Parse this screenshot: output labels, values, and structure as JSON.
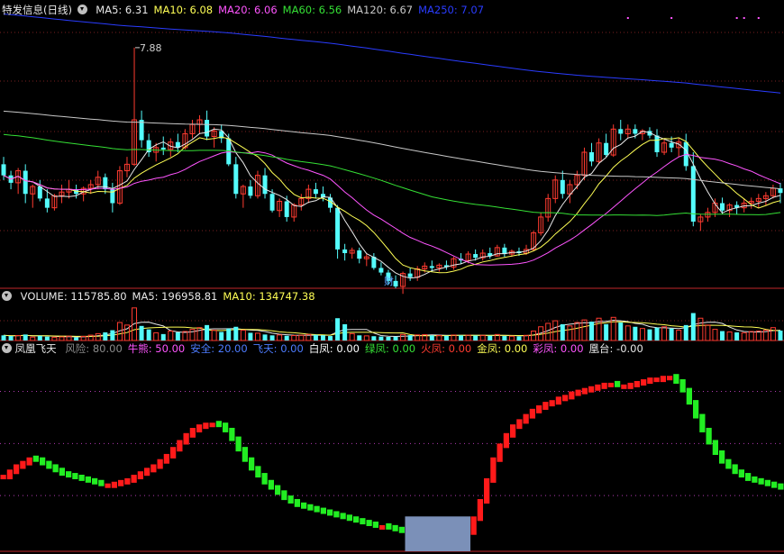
{
  "colors": {
    "background": "#000000",
    "grid": "#7a1f1f",
    "separator": "#c2262a",
    "up": "#ff3b30",
    "down": "#54fcfc",
    "ma5": "#e8e8e8",
    "ma10": "#ffff55",
    "ma20": "#ff55ff",
    "ma60": "#35e035",
    "ma120": "#c8c8c8",
    "ma250": "#2a3cff",
    "pane3_grid": "#b03ab0",
    "block": "#7b90b8"
  },
  "price_panel": {
    "title": "特发信息(日线)",
    "ma": [
      {
        "label": "MA5:",
        "value": "6.31",
        "color": "#e8e8e8"
      },
      {
        "label": "MA10:",
        "value": "6.08",
        "color": "#ffff55"
      },
      {
        "label": "MA20:",
        "value": "6.06",
        "color": "#ff55ff"
      },
      {
        "label": "MA60:",
        "value": "6.56",
        "color": "#35e035"
      },
      {
        "label": "MA120:",
        "value": "6.67",
        "color": "#c8c8c8"
      },
      {
        "label": "MA250:",
        "value": "7.07",
        "color": "#2a3cff"
      }
    ],
    "annotations": {
      "high_label": "7.88",
      "event_marker": "财"
    }
  },
  "volume_panel": {
    "items": [
      {
        "label": "VOLUME:",
        "value": "115785.80",
        "color": "#e8e8e8"
      },
      {
        "label": "MA5:",
        "value": "196958.81",
        "color": "#e8e8e8"
      },
      {
        "label": "MA10:",
        "value": "134747.38",
        "color": "#ffff55"
      }
    ]
  },
  "indicator_panel": {
    "title": "凤凰飞天",
    "items": [
      {
        "label": "风险:",
        "value": "80.00",
        "color": "#8a8a8a"
      },
      {
        "label": "牛熊:",
        "value": "50.00",
        "color": "#ff55ff"
      },
      {
        "label": "安全:",
        "value": "20.00",
        "color": "#4d7cff"
      },
      {
        "label": "飞天:",
        "value": "0.00",
        "color": "#4d7cff"
      },
      {
        "label": "白凤:",
        "value": "0.00",
        "color": "#ffffff"
      },
      {
        "label": "绿凤:",
        "value": "0.00",
        "color": "#35e035"
      },
      {
        "label": "火凤:",
        "value": "0.00",
        "color": "#ff3b30"
      },
      {
        "label": "金凤:",
        "value": "0.00",
        "color": "#ffff55"
      },
      {
        "label": "彩凤:",
        "value": "0.00",
        "color": "#ff55ff"
      },
      {
        "label": "凰台:",
        "value": "-0.00",
        "color": "#e8e8e8"
      }
    ]
  },
  "chart_data": [
    {
      "type": "candlestick",
      "title": "特发信息(日线)",
      "ylim": [
        5.3,
        8.2
      ],
      "note": "values estimated from the visible chart",
      "ohlc": [
        [
          6.62,
          6.7,
          6.45,
          6.5
        ],
        [
          6.5,
          6.55,
          6.35,
          6.42
        ],
        [
          6.42,
          6.58,
          6.3,
          6.55
        ],
        [
          6.55,
          6.62,
          6.2,
          6.3
        ],
        [
          6.3,
          6.4,
          6.15,
          6.38
        ],
        [
          6.38,
          6.45,
          6.22,
          6.25
        ],
        [
          6.25,
          6.35,
          6.1,
          6.15
        ],
        [
          6.15,
          6.3,
          6.12,
          6.28
        ],
        [
          6.28,
          6.4,
          6.2,
          6.32
        ],
        [
          6.32,
          6.45,
          6.25,
          6.35
        ],
        [
          6.35,
          6.4,
          6.25,
          6.3
        ],
        [
          6.3,
          6.38,
          6.22,
          6.36
        ],
        [
          6.36,
          6.45,
          6.3,
          6.4
        ],
        [
          6.4,
          6.55,
          6.35,
          6.48
        ],
        [
          6.48,
          6.52,
          6.3,
          6.35
        ],
        [
          6.35,
          6.42,
          6.1,
          6.2
        ],
        [
          6.2,
          6.6,
          6.18,
          6.55
        ],
        [
          6.55,
          6.7,
          6.48,
          6.62
        ],
        [
          6.62,
          7.88,
          6.6,
          7.1
        ],
        [
          7.1,
          7.2,
          6.8,
          6.88
        ],
        [
          6.88,
          6.95,
          6.7,
          6.75
        ],
        [
          6.75,
          6.85,
          6.65,
          6.8
        ],
        [
          6.8,
          6.92,
          6.72,
          6.78
        ],
        [
          6.78,
          6.9,
          6.7,
          6.86
        ],
        [
          6.86,
          6.95,
          6.75,
          6.8
        ],
        [
          6.8,
          7.0,
          6.78,
          6.95
        ],
        [
          6.95,
          7.1,
          6.9,
          7.05
        ],
        [
          7.05,
          7.15,
          6.95,
          7.1
        ],
        [
          7.1,
          7.2,
          6.88,
          6.92
        ],
        [
          6.92,
          7.02,
          6.8,
          6.98
        ],
        [
          6.98,
          7.05,
          6.85,
          6.9
        ],
        [
          6.9,
          6.95,
          6.6,
          6.62
        ],
        [
          6.62,
          6.7,
          6.25,
          6.3
        ],
        [
          6.3,
          6.4,
          6.15,
          6.38
        ],
        [
          6.38,
          6.45,
          6.25,
          6.28
        ],
        [
          6.28,
          6.55,
          6.25,
          6.5
        ],
        [
          6.5,
          6.58,
          6.25,
          6.3
        ],
        [
          6.3,
          6.35,
          6.1,
          6.12
        ],
        [
          6.12,
          6.25,
          6.05,
          6.22
        ],
        [
          6.22,
          6.28,
          6.0,
          6.05
        ],
        [
          6.05,
          6.2,
          6.0,
          6.18
        ],
        [
          6.18,
          6.3,
          6.12,
          6.25
        ],
        [
          6.25,
          6.4,
          6.2,
          6.35
        ],
        [
          6.35,
          6.42,
          6.25,
          6.3
        ],
        [
          6.3,
          6.38,
          6.22,
          6.26
        ],
        [
          6.26,
          6.3,
          6.1,
          6.15
        ],
        [
          6.15,
          6.18,
          5.6,
          5.7
        ],
        [
          5.7,
          5.76,
          5.58,
          5.66
        ],
        [
          5.66,
          5.72,
          5.6,
          5.69
        ],
        [
          5.69,
          5.72,
          5.55,
          5.6
        ],
        [
          5.6,
          5.65,
          5.52,
          5.62
        ],
        [
          5.62,
          5.66,
          5.48,
          5.5
        ],
        [
          5.5,
          5.56,
          5.42,
          5.45
        ],
        [
          5.45,
          5.48,
          5.32,
          5.36
        ],
        [
          5.36,
          5.42,
          5.28,
          5.3
        ],
        [
          5.3,
          5.46,
          5.22,
          5.44
        ],
        [
          5.44,
          5.5,
          5.36,
          5.4
        ],
        [
          5.4,
          5.52,
          5.36,
          5.49
        ],
        [
          5.49,
          5.56,
          5.45,
          5.52
        ],
        [
          5.52,
          5.58,
          5.46,
          5.5
        ],
        [
          5.5,
          5.55,
          5.46,
          5.53
        ],
        [
          5.53,
          5.58,
          5.48,
          5.51
        ],
        [
          5.51,
          5.62,
          5.48,
          5.6
        ],
        [
          5.6,
          5.66,
          5.54,
          5.58
        ],
        [
          5.58,
          5.68,
          5.55,
          5.65
        ],
        [
          5.65,
          5.7,
          5.58,
          5.61
        ],
        [
          5.61,
          5.7,
          5.58,
          5.66
        ],
        [
          5.66,
          5.72,
          5.6,
          5.63
        ],
        [
          5.63,
          5.75,
          5.62,
          5.72
        ],
        [
          5.72,
          5.76,
          5.62,
          5.65
        ],
        [
          5.65,
          5.7,
          5.62,
          5.68
        ],
        [
          5.68,
          5.72,
          5.63,
          5.66
        ],
        [
          5.66,
          5.75,
          5.64,
          5.7
        ],
        [
          5.7,
          5.9,
          5.68,
          5.88
        ],
        [
          5.88,
          6.1,
          5.85,
          6.05
        ],
        [
          6.05,
          6.3,
          6.0,
          6.25
        ],
        [
          6.25,
          6.5,
          6.2,
          6.45
        ],
        [
          6.45,
          6.55,
          6.25,
          6.3
        ],
        [
          6.3,
          6.45,
          6.2,
          6.4
        ],
        [
          6.4,
          6.55,
          6.35,
          6.5
        ],
        [
          6.5,
          6.8,
          6.45,
          6.75
        ],
        [
          6.75,
          6.85,
          6.6,
          6.65
        ],
        [
          6.65,
          6.9,
          6.62,
          6.85
        ],
        [
          6.85,
          6.95,
          6.7,
          6.72
        ],
        [
          6.72,
          7.05,
          6.7,
          7.0
        ],
        [
          7.0,
          7.1,
          6.88,
          6.95
        ],
        [
          6.95,
          7.05,
          6.9,
          7.0
        ],
        [
          7.0,
          7.05,
          6.9,
          6.95
        ],
        [
          6.95,
          7.0,
          6.88,
          6.98
        ],
        [
          6.98,
          7.02,
          6.9,
          6.93
        ],
        [
          6.93,
          7.0,
          6.7,
          6.75
        ],
        [
          6.75,
          6.9,
          6.72,
          6.85
        ],
        [
          6.85,
          6.92,
          6.75,
          6.8
        ],
        [
          6.8,
          6.9,
          6.7,
          6.86
        ],
        [
          6.86,
          6.95,
          6.55,
          6.6
        ],
        [
          6.6,
          6.75,
          5.95,
          6.0
        ],
        [
          6.0,
          6.08,
          5.9,
          6.05
        ],
        [
          6.05,
          6.15,
          6.0,
          6.1
        ],
        [
          6.1,
          6.25,
          6.05,
          6.2
        ],
        [
          6.2,
          6.26,
          6.08,
          6.12
        ],
        [
          6.12,
          6.2,
          6.05,
          6.18
        ],
        [
          6.18,
          6.22,
          6.08,
          6.15
        ],
        [
          6.15,
          6.25,
          6.1,
          6.2
        ],
        [
          6.2,
          6.26,
          6.14,
          6.22
        ],
        [
          6.22,
          6.3,
          6.15,
          6.25
        ],
        [
          6.25,
          6.32,
          6.18,
          6.28
        ],
        [
          6.28,
          6.4,
          6.25,
          6.36
        ],
        [
          6.36,
          6.42,
          6.2,
          6.31
        ]
      ],
      "series": [
        {
          "name": "MA5"
        },
        {
          "name": "MA10"
        },
        {
          "name": "MA20"
        },
        {
          "name": "MA60"
        },
        {
          "name": "MA120"
        },
        {
          "name": "MA250"
        }
      ]
    },
    {
      "type": "bar",
      "title": "VOLUME",
      "ylim": [
        0,
        420000
      ],
      "values": [
        60000,
        52000,
        58000,
        70000,
        40000,
        55000,
        45000,
        38000,
        42000,
        50000,
        36000,
        48000,
        62000,
        80000,
        95000,
        120000,
        210000,
        180000,
        380000,
        170000,
        130000,
        90000,
        75000,
        110000,
        95000,
        105000,
        130000,
        150000,
        180000,
        120000,
        100000,
        140000,
        160000,
        120000,
        90000,
        85000,
        70000,
        60000,
        65000,
        55000,
        58000,
        62000,
        70000,
        66000,
        60000,
        52000,
        260000,
        190000,
        80000,
        60000,
        54000,
        50000,
        46000,
        42000,
        44000,
        70000,
        62000,
        65000,
        68000,
        60000,
        58000,
        55000,
        64000,
        60000,
        62000,
        58000,
        60000,
        56000,
        70000,
        52000,
        50000,
        48000,
        60000,
        110000,
        160000,
        200000,
        230000,
        190000,
        170000,
        210000,
        240000,
        220000,
        260000,
        190000,
        270000,
        210000,
        170000,
        160000,
        140000,
        130000,
        150000,
        160000,
        140000,
        120000,
        180000,
        320000,
        260000,
        180000,
        130000,
        110000,
        100000,
        95000,
        90000,
        105000,
        110000,
        120000,
        150000,
        115786
      ],
      "series": [
        {
          "name": "MA5"
        },
        {
          "name": "MA10"
        }
      ]
    },
    {
      "type": "bar",
      "title": "凤凰飞天",
      "ylim": [
        -10,
        100
      ],
      "reference_lines": [
        80,
        50,
        20
      ],
      "values": [
        32,
        35,
        38,
        40,
        42,
        41,
        39,
        37,
        35,
        33,
        32,
        31,
        30,
        29,
        28,
        27,
        27,
        28,
        29,
        30,
        32,
        34,
        36,
        38,
        41,
        44,
        48,
        52,
        56,
        59,
        61,
        62,
        62,
        61,
        58,
        53,
        47,
        41,
        36,
        32,
        28,
        25,
        22,
        19,
        17,
        15,
        14,
        13,
        12,
        11,
        10,
        9,
        8,
        7,
        6,
        5,
        4,
        3,
        3,
        2,
        1,
        0,
        0,
        0,
        0,
        0,
        0,
        0,
        0,
        0,
        0,
        0,
        8,
        18,
        30,
        42,
        50,
        56,
        61,
        64,
        67,
        70,
        72,
        74,
        75,
        77,
        78,
        80,
        81,
        82,
        83,
        84,
        85,
        85,
        84,
        84,
        85,
        86,
        87,
        88,
        88,
        89,
        89,
        86,
        81,
        74,
        66,
        58,
        51,
        45,
        40,
        37,
        34,
        32,
        30,
        29,
        28,
        27,
        26,
        25
      ],
      "block": {
        "from": 62,
        "to": 71,
        "value": 8
      }
    }
  ]
}
